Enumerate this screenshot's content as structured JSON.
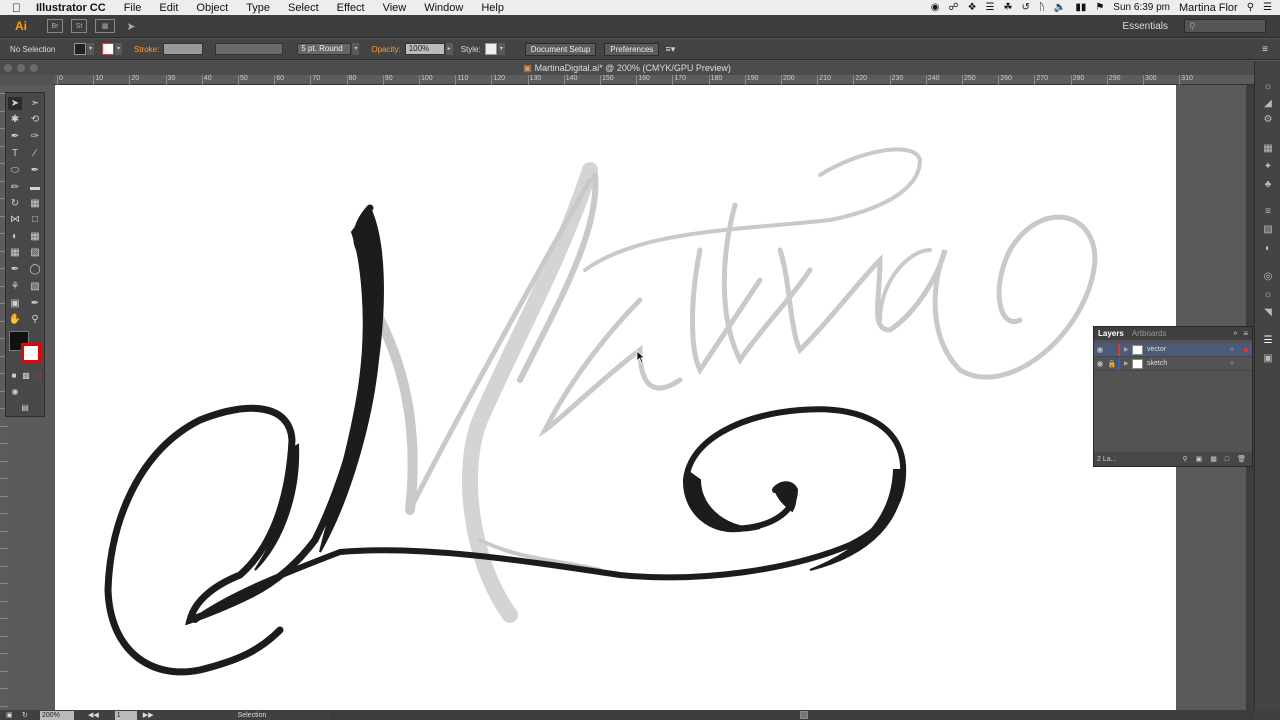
{
  "menubar": {
    "app_name": "Illustrator CC",
    "items": [
      "File",
      "Edit",
      "Object",
      "Type",
      "Select",
      "Effect",
      "View",
      "Window",
      "Help"
    ],
    "time": "Sun 6:39 pm",
    "user": "Martina Flor"
  },
  "appbar": {
    "logo": "Ai",
    "bridge": "Br",
    "stock": "St",
    "workspace": "Essentials"
  },
  "controlbar": {
    "selection": "No Selection",
    "stroke_label": "Stroke:",
    "brush": "5 pt. Round",
    "opacity_label": "Opacity:",
    "opacity": "100%",
    "style_label": "Style:",
    "document_setup": "Document Setup",
    "preferences": "Preferences"
  },
  "document": {
    "title": "MartinaDigital.ai* @ 200% (CMYK/GPU Preview)"
  },
  "ruler": {
    "labels": [
      "0",
      "10",
      "20",
      "30",
      "40",
      "50",
      "60",
      "70",
      "80",
      "90",
      "100",
      "110",
      "120",
      "130",
      "140",
      "150",
      "160",
      "170",
      "180",
      "190",
      "200",
      "210",
      "220",
      "230",
      "240",
      "250",
      "260",
      "270",
      "280",
      "290",
      "300",
      "310"
    ]
  },
  "layers_panel": {
    "tabs": [
      "Layers",
      "Artboards"
    ],
    "layers": [
      {
        "name": "vector",
        "color": "#e0372e",
        "selected": true
      },
      {
        "name": "sketch",
        "color": "#3060d0",
        "selected": false
      }
    ],
    "count": "2 La..."
  },
  "statusbar": {
    "zoom": "200%",
    "page": "1",
    "status": "Selection"
  }
}
